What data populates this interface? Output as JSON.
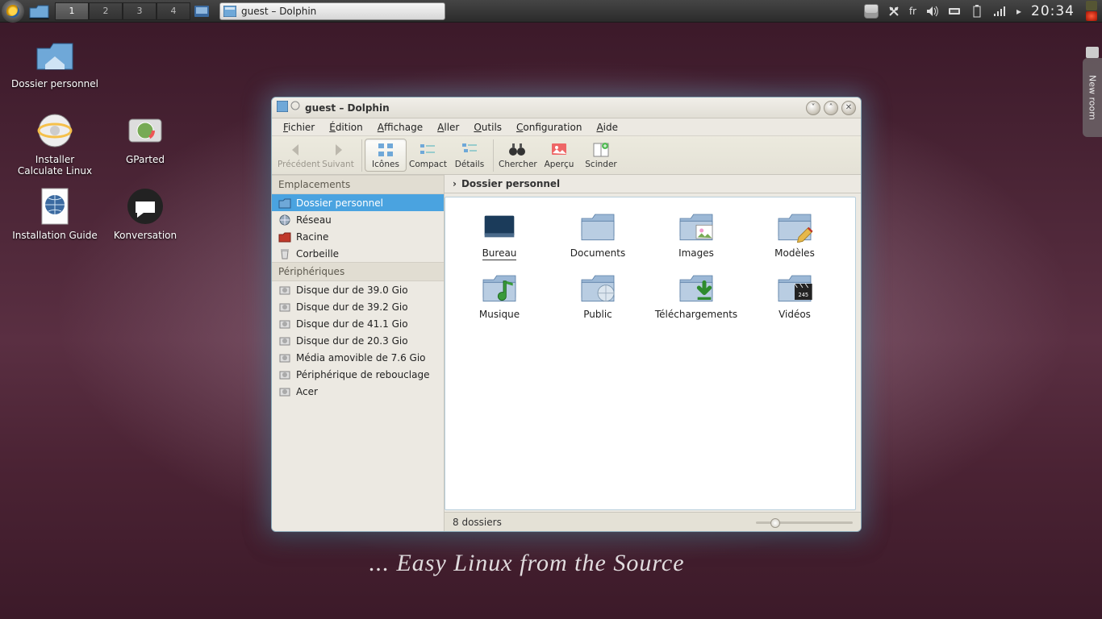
{
  "panel": {
    "pager": [
      "1",
      "2",
      "3",
      "4"
    ],
    "pager_active": 0,
    "task_title": "guest – Dolphin",
    "lang": "fr",
    "clock": "20:34"
  },
  "desktop_icons": [
    {
      "name": "home-folder-icon",
      "label": "Dossier personnel",
      "type": "folder-home"
    },
    {
      "name": "installer-icon",
      "label": "Installer Calculate Linux",
      "type": "installer"
    },
    {
      "name": "gparted-icon",
      "label": "GParted",
      "type": "disk"
    },
    {
      "name": "guide-icon",
      "label": "Installation Guide",
      "type": "doc-globe"
    },
    {
      "name": "konversation-icon",
      "label": "Konversation",
      "type": "chat"
    }
  ],
  "wallpaper_text": "... Easy Linux from the Source",
  "edge_tab": "New room",
  "window": {
    "title": "guest – Dolphin",
    "menu": [
      "Fichier",
      "Édition",
      "Affichage",
      "Aller",
      "Outils",
      "Configuration",
      "Aide"
    ],
    "toolbar": {
      "back": "Précédent",
      "forward": "Suivant",
      "icons": "Icônes",
      "compact": "Compact",
      "details": "Détails",
      "search": "Chercher",
      "preview": "Aperçu",
      "split": "Scinder"
    },
    "sidebar": {
      "places_header": "Emplacements",
      "places": [
        {
          "label": "Dossier personnel",
          "icon": "folder-blue",
          "selected": true
        },
        {
          "label": "Réseau",
          "icon": "globe"
        },
        {
          "label": "Racine",
          "icon": "folder-red"
        },
        {
          "label": "Corbeille",
          "icon": "trash"
        }
      ],
      "devices_header": "Périphériques",
      "devices": [
        {
          "label": "Disque dur de 39.0 Gio"
        },
        {
          "label": "Disque dur de 39.2 Gio"
        },
        {
          "label": "Disque dur de 41.1 Gio"
        },
        {
          "label": "Disque dur de 20.3 Gio"
        },
        {
          "label": "Média amovible de 7.6 Gio"
        },
        {
          "label": "Périphérique de rebouclage"
        },
        {
          "label": "Acer"
        }
      ]
    },
    "crumb": "Dossier personnel",
    "files": [
      {
        "label": "Bureau",
        "overlay": "desktop",
        "selected": true
      },
      {
        "label": "Documents"
      },
      {
        "label": "Images",
        "overlay": "photo"
      },
      {
        "label": "Modèles",
        "overlay": "pencil"
      },
      {
        "label": "Musique",
        "overlay": "note"
      },
      {
        "label": "Public",
        "overlay": "globe"
      },
      {
        "label": "Téléchargements",
        "overlay": "download"
      },
      {
        "label": "Vidéos",
        "overlay": "clap"
      }
    ],
    "status": "8 dossiers",
    "zoom_pct": 18
  }
}
